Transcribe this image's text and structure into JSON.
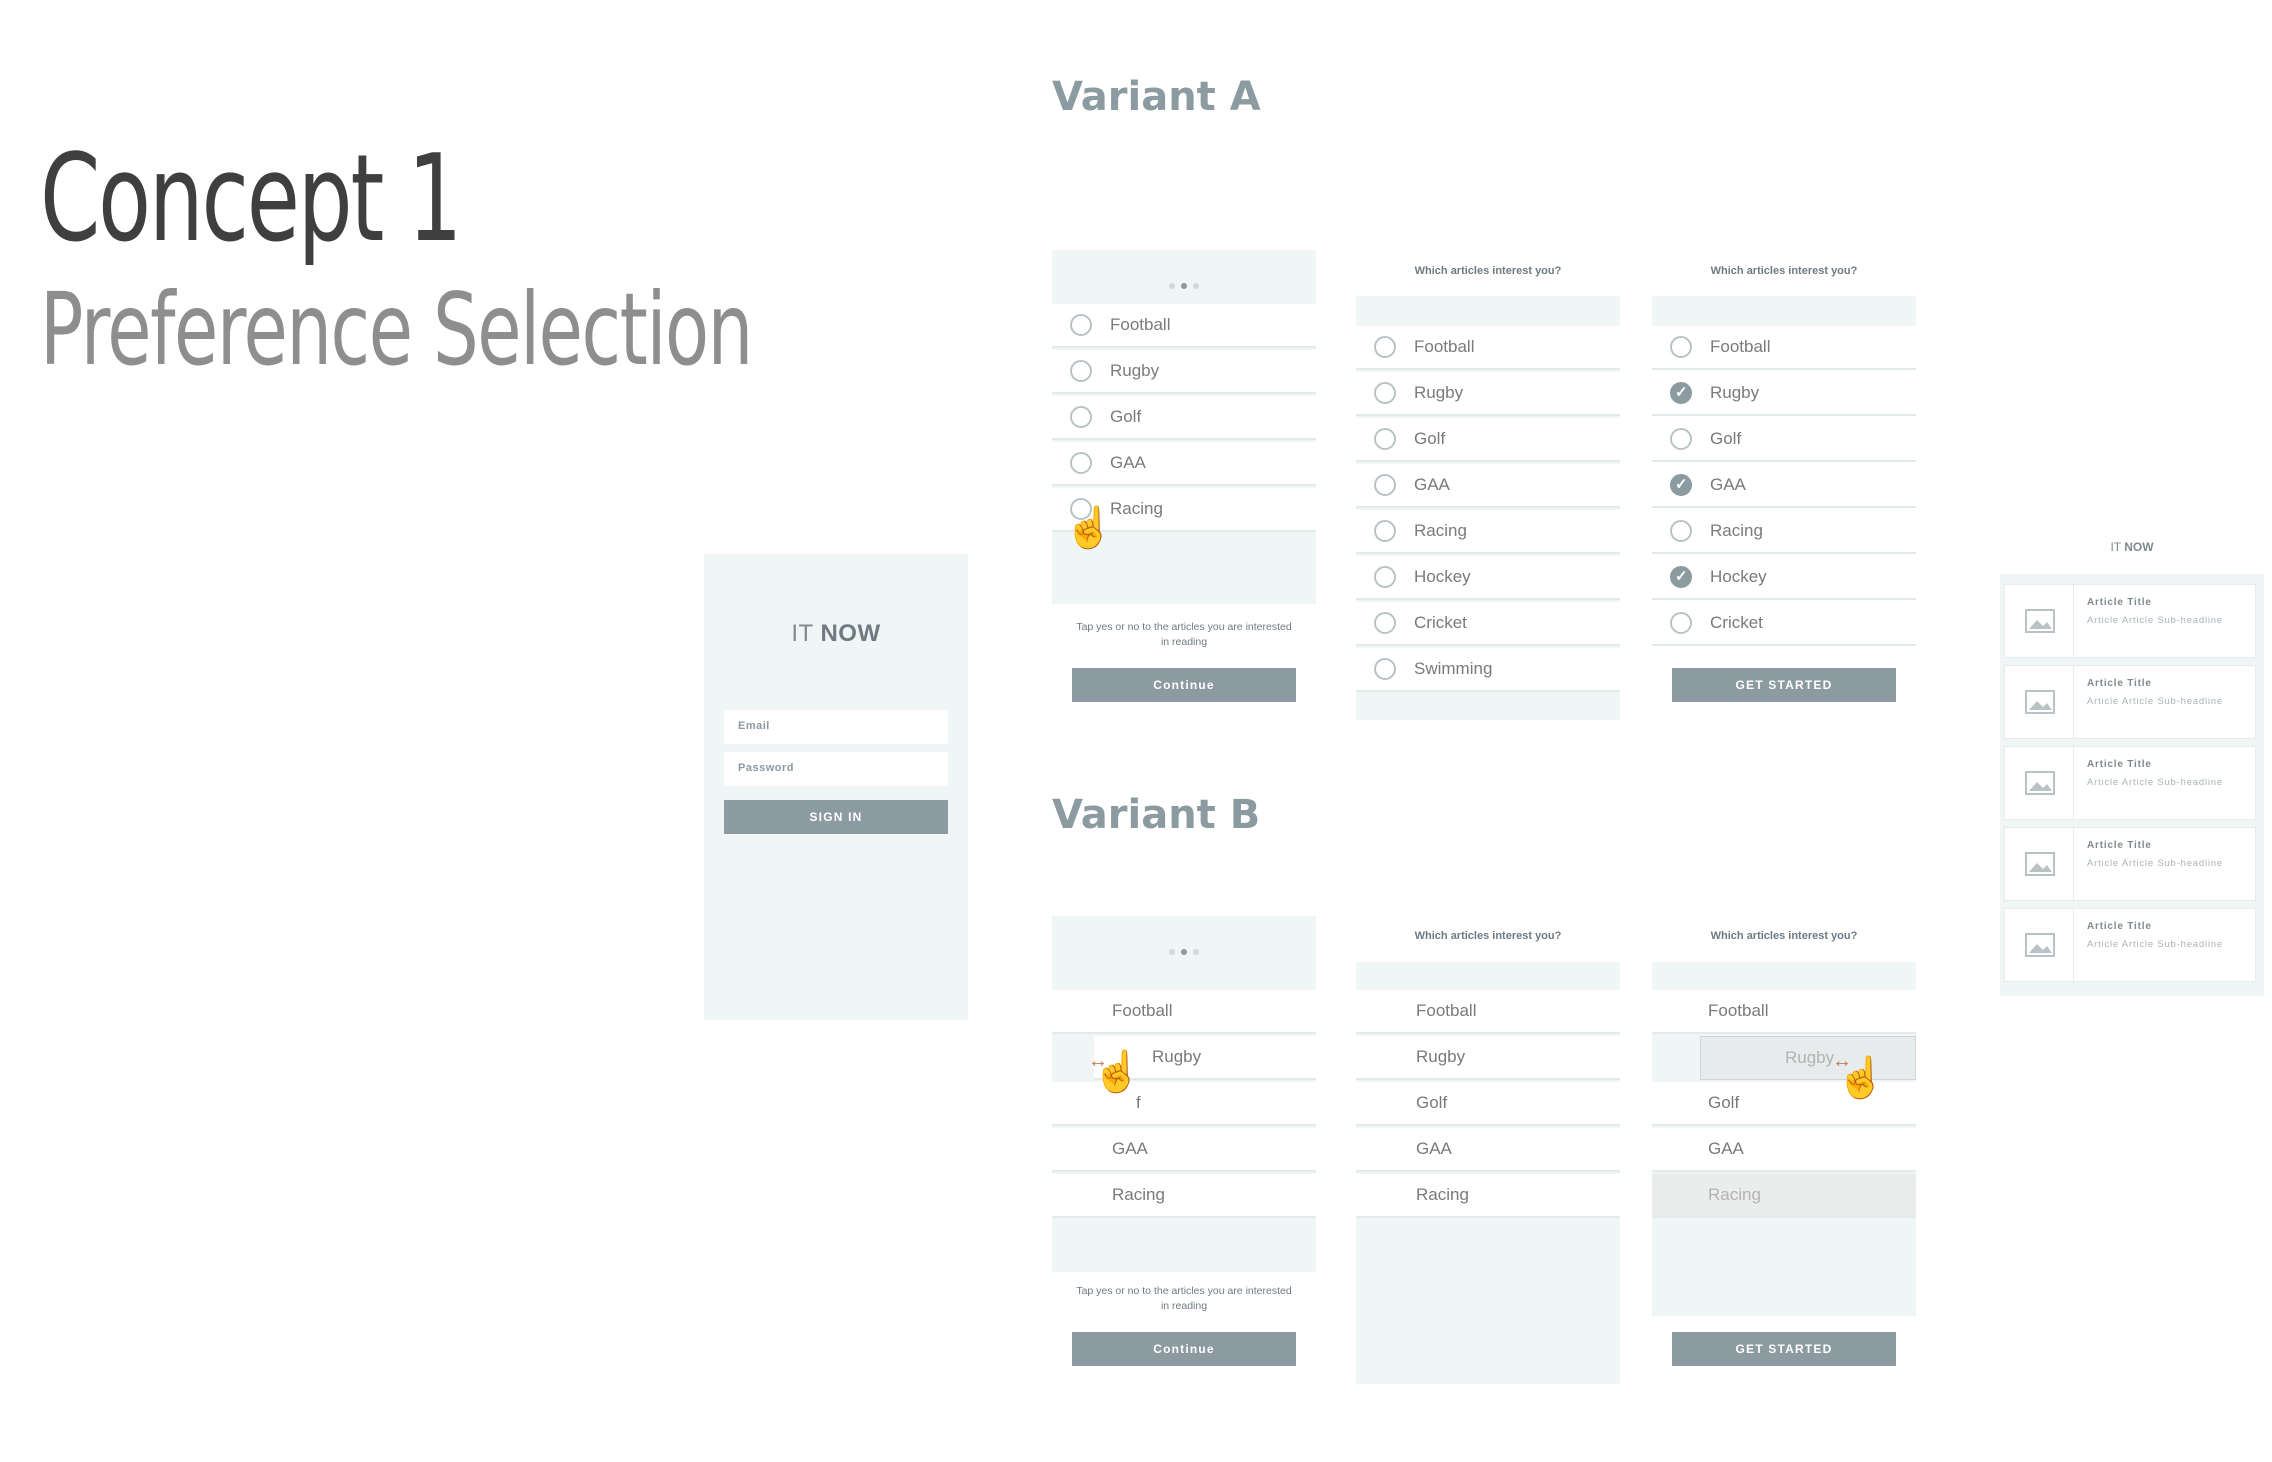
{
  "header": {
    "title": "Concept 1",
    "subtitle": "Preference Selection",
    "variant_a": "Variant A",
    "variant_b": "Variant B"
  },
  "login": {
    "logo_it": "IT",
    "logo_now": "NOW",
    "email_placeholder": "Email",
    "password_placeholder": "Password",
    "signin": "SIGN IN"
  },
  "variant_a": {
    "screen1": {
      "items": [
        "Football",
        "Rugby",
        "Golf",
        "GAA",
        "Racing"
      ],
      "hint": "Tap yes or no to the articles you are interested in reading",
      "button": "Continue"
    },
    "screen2": {
      "question": "Which articles interest you?",
      "items": [
        "Football",
        "Rugby",
        "Golf",
        "GAA",
        "Racing",
        "Hockey",
        "Cricket",
        "Swimming"
      ]
    },
    "screen3": {
      "question": "Which articles interest you?",
      "items": [
        {
          "label": "Football",
          "checked": false
        },
        {
          "label": "Rugby",
          "checked": true
        },
        {
          "label": "Golf",
          "checked": false
        },
        {
          "label": "GAA",
          "checked": true
        },
        {
          "label": "Racing",
          "checked": false
        },
        {
          "label": "Hockey",
          "checked": true
        },
        {
          "label": "Cricket",
          "checked": false
        }
      ],
      "button": "GET STARTED"
    }
  },
  "variant_b": {
    "screen1": {
      "items": [
        "Football",
        "Rugby",
        "f",
        "GAA",
        "Racing"
      ],
      "hint": "Tap yes or no to the articles you are interested in reading",
      "button": "Continue"
    },
    "screen2": {
      "question": "Which articles interest you?",
      "items": [
        "Football",
        "Rugby",
        "Golf",
        "GAA",
        "Racing"
      ]
    },
    "screen3": {
      "question": "Which articles interest you?",
      "items": [
        "Football",
        "Rugby",
        "Golf",
        "GAA",
        "Racing"
      ],
      "button": "GET STARTED"
    }
  },
  "feed": {
    "logo_it": "IT",
    "logo_now": "NOW",
    "articles": [
      {
        "title": "Article Title",
        "sub": "Article Article Sub-headline"
      },
      {
        "title": "Article Title",
        "sub": "Article Article Sub-headline"
      },
      {
        "title": "Article Title",
        "sub": "Article Article Sub-headline"
      },
      {
        "title": "Article Title",
        "sub": "Article Article Sub-headline"
      },
      {
        "title": "Article Title",
        "sub": "Article Article Sub-headline"
      }
    ]
  }
}
